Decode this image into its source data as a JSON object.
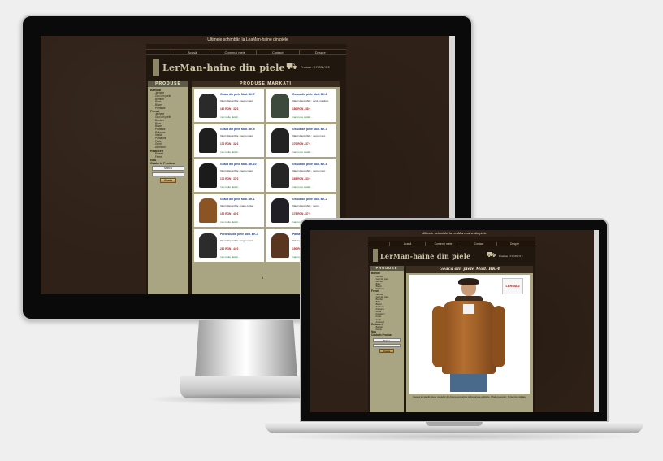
{
  "site": {
    "top_text": "Ultimele schimbări la LeaMan-haine din piele",
    "logo": "LerMan-haine din piele",
    "cart_text": "Produse : 0 RON / 0 €",
    "nav": [
      "Acasă",
      "Comenzi mele",
      "Contact",
      "Despre"
    ]
  },
  "desktop": {
    "sidebar_title": "PRODUSE",
    "main_title": "PRODUSE MARKATI",
    "categories": [
      {
        "label": "Barbati",
        "items": [
          "Jachete",
          "Geci din piele",
          "Bomber",
          "Biker",
          "Blazer",
          "Pardesie"
        ]
      },
      {
        "label": "Femei",
        "items": [
          "Jachete",
          "Geci din piele",
          "Bomber",
          "Biker",
          "Blazer",
          "Pardesie",
          "Paltoane",
          "Vestă",
          "Pantaloni",
          "Fuste",
          "Genți",
          "Accesorii"
        ]
      },
      {
        "label": "Reduceri",
        "items": [
          "Barbati",
          "Femei"
        ]
      }
    ],
    "sidebar_extra": [
      "Nou",
      "Cauta in Produse"
    ],
    "select_value": "Marca",
    "search_button": "Cauta",
    "products": [
      {
        "title": "Geaca din piele Mod. BK-7",
        "stock": "Valori disponibile : negru maro",
        "price": "160 RON - 32 €",
        "more": "mai multe detalii ...",
        "color": "#2a2a2a"
      },
      {
        "title": "Geaca din piele Mod. BK-8",
        "stock": "Valori disponibile : verde masliniu",
        "price": "180 RON - 38 €",
        "more": "mai multe detalii ...",
        "color": "#3b4a3c"
      },
      {
        "title": "Geaca din piele Mod. BK-5",
        "stock": "Valori disponibile : negru maro",
        "price": "170 RON - 32 €",
        "more": "mai multe detalii ...",
        "color": "#1e1e1e"
      },
      {
        "title": "Geaca din piele Mod. BK-3",
        "stock": "Valori disponibile : negru maro",
        "price": "170 RON - 37 €",
        "more": "mai multe detalii ...",
        "color": "#222222"
      },
      {
        "title": "Geaca din piele Mod. BK-10",
        "stock": "Valori disponibile : negru maro",
        "price": "170 RON - 37 €",
        "more": "mai multe detalii ...",
        "color": "#1b1b1b"
      },
      {
        "title": "Geaca din piele Mod. BK-6",
        "stock": "Valori disponibile : negru maro",
        "price": "165 RON - 33 €",
        "more": "mai multe detalii ...",
        "color": "#262626"
      },
      {
        "title": "Geaca din piele Mod. BK-1",
        "stock": "Valori disponibile : maro coniac",
        "price": "190 RON - 40 €",
        "more": "mai multe detalii ...",
        "color": "#8a5424"
      },
      {
        "title": "Geaca din piele Mod. BK-2",
        "stock": "Valori disponibile : negru",
        "price": "175 RON - 37 €",
        "more": "mai multe detalii ...",
        "color": "#1f1f25"
      },
      {
        "title": "Pardesiu din piele Mod. BK-3",
        "stock": "Valori disponibile : negru maro",
        "price": "210 RON - 44 €",
        "more": "mai multe detalii ...",
        "color": "#2c2c2c"
      },
      {
        "title": "Pantaloni din piele",
        "stock": "Valori disponibile : maro",
        "price": "150 RON - 31 €",
        "more": "mai multe detalii ...",
        "color": "#5a3520"
      }
    ],
    "pager": "1"
  },
  "laptop": {
    "sidebar_title": "PRODUSE",
    "main_title": "Geaca din piele Mod. BK-4",
    "stamp_text": "LERMAN",
    "description": "Geaca lunga din piele cu guler din blana ecologica si buzunare aplicate. Model elegant, finisaj de calitate.",
    "select_value": "Marca",
    "search_button": "Cauta"
  }
}
